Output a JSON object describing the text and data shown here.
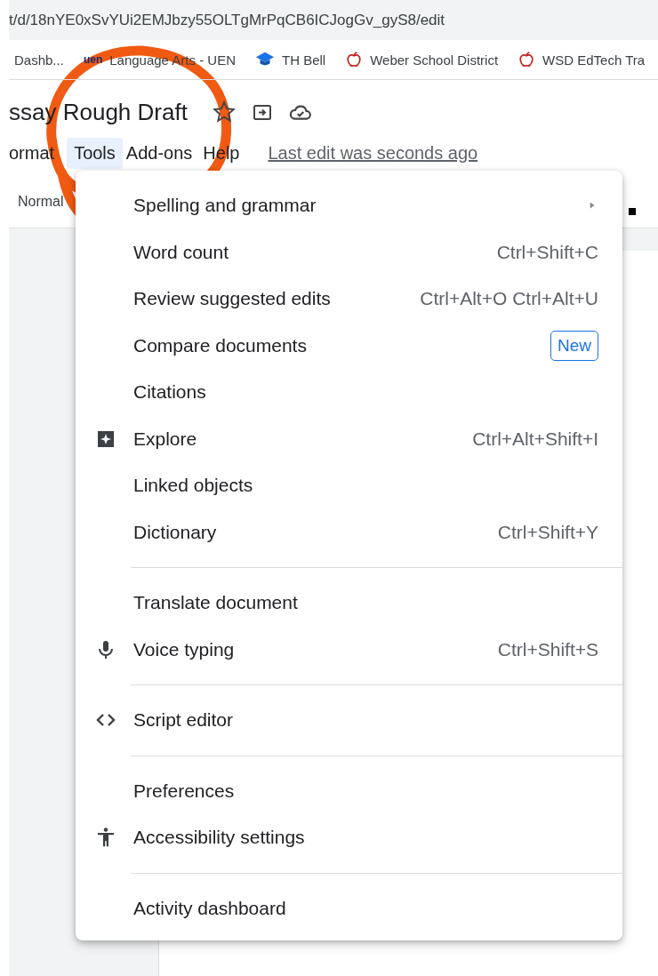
{
  "address_bar": {
    "url": "t/d/18nYE0xSvYUi2EMJbzy55OLTgMrPqCB6ICJogGv_gyS8/edit"
  },
  "bookmarks": [
    {
      "label": "Dashb...",
      "kind": "plain"
    },
    {
      "label": "Language Arts - UEN",
      "kind": "logo",
      "logo_text": "uen"
    },
    {
      "label": "TH Bell",
      "kind": "cap"
    },
    {
      "label": "Weber School District",
      "kind": "apple"
    },
    {
      "label": "WSD EdTech Tra",
      "kind": "apple"
    }
  ],
  "document": {
    "title": "ssay Rough Draft"
  },
  "menu_bar": [
    {
      "label": "ormat",
      "selected": false
    },
    {
      "label": "Tools",
      "selected": true
    },
    {
      "label": "Add-ons",
      "selected": false
    },
    {
      "label": "Help",
      "selected": false
    }
  ],
  "last_edit": "Last edit was seconds ago",
  "toolbar": {
    "style": "Normal"
  },
  "tools_menu": [
    {
      "kind": "submenu",
      "label": "Spelling and grammar"
    },
    {
      "kind": "item",
      "label": "Word count",
      "shortcut": "Ctrl+Shift+C"
    },
    {
      "kind": "item",
      "label": "Review suggested edits",
      "shortcut": "Ctrl+Alt+O Ctrl+Alt+U"
    },
    {
      "kind": "item",
      "label": "Compare documents",
      "badge": "New"
    },
    {
      "kind": "item",
      "label": "Citations"
    },
    {
      "kind": "item",
      "label": "Explore",
      "shortcut": "Ctrl+Alt+Shift+I"
    },
    {
      "kind": "item",
      "label": "Linked objects"
    },
    {
      "kind": "item",
      "label": "Dictionary",
      "shortcut": "Ctrl+Shift+Y"
    },
    {
      "kind": "divider"
    },
    {
      "kind": "item",
      "label": "Translate document"
    },
    {
      "kind": "item",
      "label": "Voice typing",
      "shortcut": "Ctrl+Shift+S"
    },
    {
      "kind": "divider"
    },
    {
      "kind": "item",
      "label": "Script editor"
    },
    {
      "kind": "divider"
    },
    {
      "kind": "item",
      "label": "Preferences"
    },
    {
      "kind": "item",
      "label": "Accessibility settings"
    },
    {
      "kind": "divider"
    },
    {
      "kind": "item",
      "label": "Activity dashboard"
    }
  ]
}
